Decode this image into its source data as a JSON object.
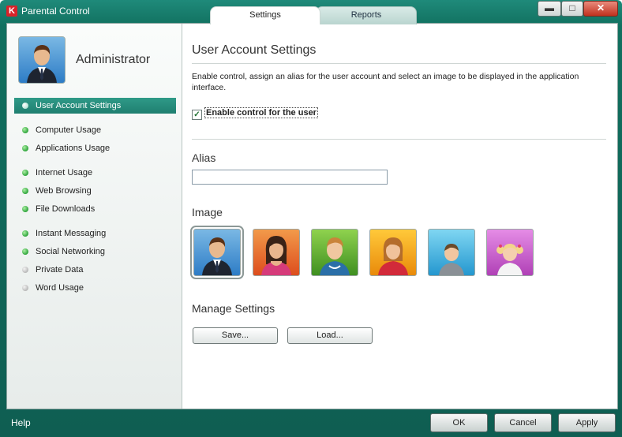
{
  "window": {
    "title": "Parental Control",
    "logo": "K",
    "controls": {
      "minimize": "▬",
      "maximize": "□",
      "close": "✕"
    }
  },
  "tabs": [
    {
      "label": "Settings",
      "active": true
    },
    {
      "label": "Reports",
      "active": false
    }
  ],
  "user": {
    "name": "Administrator",
    "avatar": "businessman-avatar-icon"
  },
  "sidebar": {
    "items": [
      {
        "label": "User Account Settings",
        "status": "active"
      },
      {
        "label": "Computer Usage",
        "status": "enabled"
      },
      {
        "label": "Applications Usage",
        "status": "enabled"
      },
      {
        "label": "Internet Usage",
        "status": "enabled"
      },
      {
        "label": "Web Browsing",
        "status": "enabled"
      },
      {
        "label": "File Downloads",
        "status": "enabled"
      },
      {
        "label": "Instant Messaging",
        "status": "enabled"
      },
      {
        "label": "Social Networking",
        "status": "enabled"
      },
      {
        "label": "Private Data",
        "status": "disabled"
      },
      {
        "label": "Word Usage",
        "status": "disabled"
      }
    ]
  },
  "main": {
    "heading": "User Account Settings",
    "description": "Enable control, assign an alias for the user account and select an image to be displayed in the application interface.",
    "enable_control": {
      "label": "Enable control for the user",
      "checked": true,
      "checkmark": "✓"
    },
    "alias": {
      "label": "Alias",
      "value": ""
    },
    "image": {
      "label": "Image",
      "options": [
        {
          "name": "businessman",
          "background": "#3f8fd6",
          "selected": true
        },
        {
          "name": "woman-dark-hair",
          "background": "#e8622a",
          "selected": false
        },
        {
          "name": "boy",
          "background": "#4aa32c",
          "selected": false
        },
        {
          "name": "girl",
          "background": "#f2a20d",
          "selected": false
        },
        {
          "name": "child",
          "background": "#3cb4e4",
          "selected": false
        },
        {
          "name": "girl-pigtails",
          "background": "#c454c6",
          "selected": false
        }
      ]
    },
    "manage": {
      "label": "Manage Settings",
      "save_label": "Save...",
      "load_label": "Load..."
    }
  },
  "footer": {
    "help_label": "Help",
    "ok_label": "OK",
    "cancel_label": "Cancel",
    "apply_label": "Apply"
  },
  "colors": {
    "accent": "#1f7f70",
    "window_frame": "#0f5e52",
    "status_enabled": "#2da43a",
    "status_disabled": "#b8b8b8"
  }
}
